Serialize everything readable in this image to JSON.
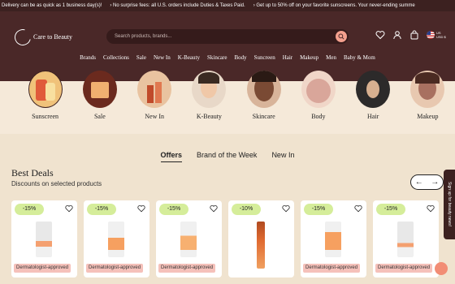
{
  "ticker": [
    "Delivery can be as quick as 1 business day(s)!",
    "› No surprise fees: all U.S. orders include Duties & Taxes Paid.",
    "› Get up to 50% off on your favorite sunscreens. Your never-ending summe"
  ],
  "brand": {
    "name": "Care to Beauty"
  },
  "search": {
    "placeholder": "Search products, brands..."
  },
  "locale": {
    "currency": "US",
    "code": "USD $"
  },
  "nav": [
    "Brands",
    "Collections",
    "Sale",
    "New In",
    "K-Beauty",
    "Skincare",
    "Body",
    "Suncreen",
    "Hair",
    "Makeup",
    "Men",
    "Baby & Mom"
  ],
  "categories": [
    {
      "label": "Sunscreen",
      "color": "#f0c27a"
    },
    {
      "label": "Sale",
      "color": "#6b2a1e"
    },
    {
      "label": "New In",
      "color": "#c77a4a"
    },
    {
      "label": "K-Beauty",
      "color": "#e8d8c8"
    },
    {
      "label": "Skincare",
      "color": "#6a4030"
    },
    {
      "label": "Body",
      "color": "#d9a69a"
    },
    {
      "label": "Hair",
      "color": "#2c2a2a"
    },
    {
      "label": "Makeup",
      "color": "#a87060"
    }
  ],
  "tabs": [
    "Offers",
    "Brand of the Week",
    "New In"
  ],
  "section": {
    "title": "Best Deals",
    "subtitle": "Discounts on selected products"
  },
  "products": [
    {
      "discount": "-15%",
      "tag": "Dermatologist-approved",
      "color": "#e8e8e8"
    },
    {
      "discount": "-15%",
      "tag": "Dermatologist-approved",
      "color": "#f6a060"
    },
    {
      "discount": "-15%",
      "tag": "Dermatologist-approved",
      "color": "#f7b070"
    },
    {
      "discount": "-10%",
      "tag": "",
      "color": "#e06a30"
    },
    {
      "discount": "-15%",
      "tag": "Dermatologist-approved",
      "color": "#f6a060"
    },
    {
      "discount": "-15%",
      "tag": "Dermatologist-approved",
      "color": "#e8e8e8"
    }
  ],
  "loyalty": "Sign up for beauty news!"
}
